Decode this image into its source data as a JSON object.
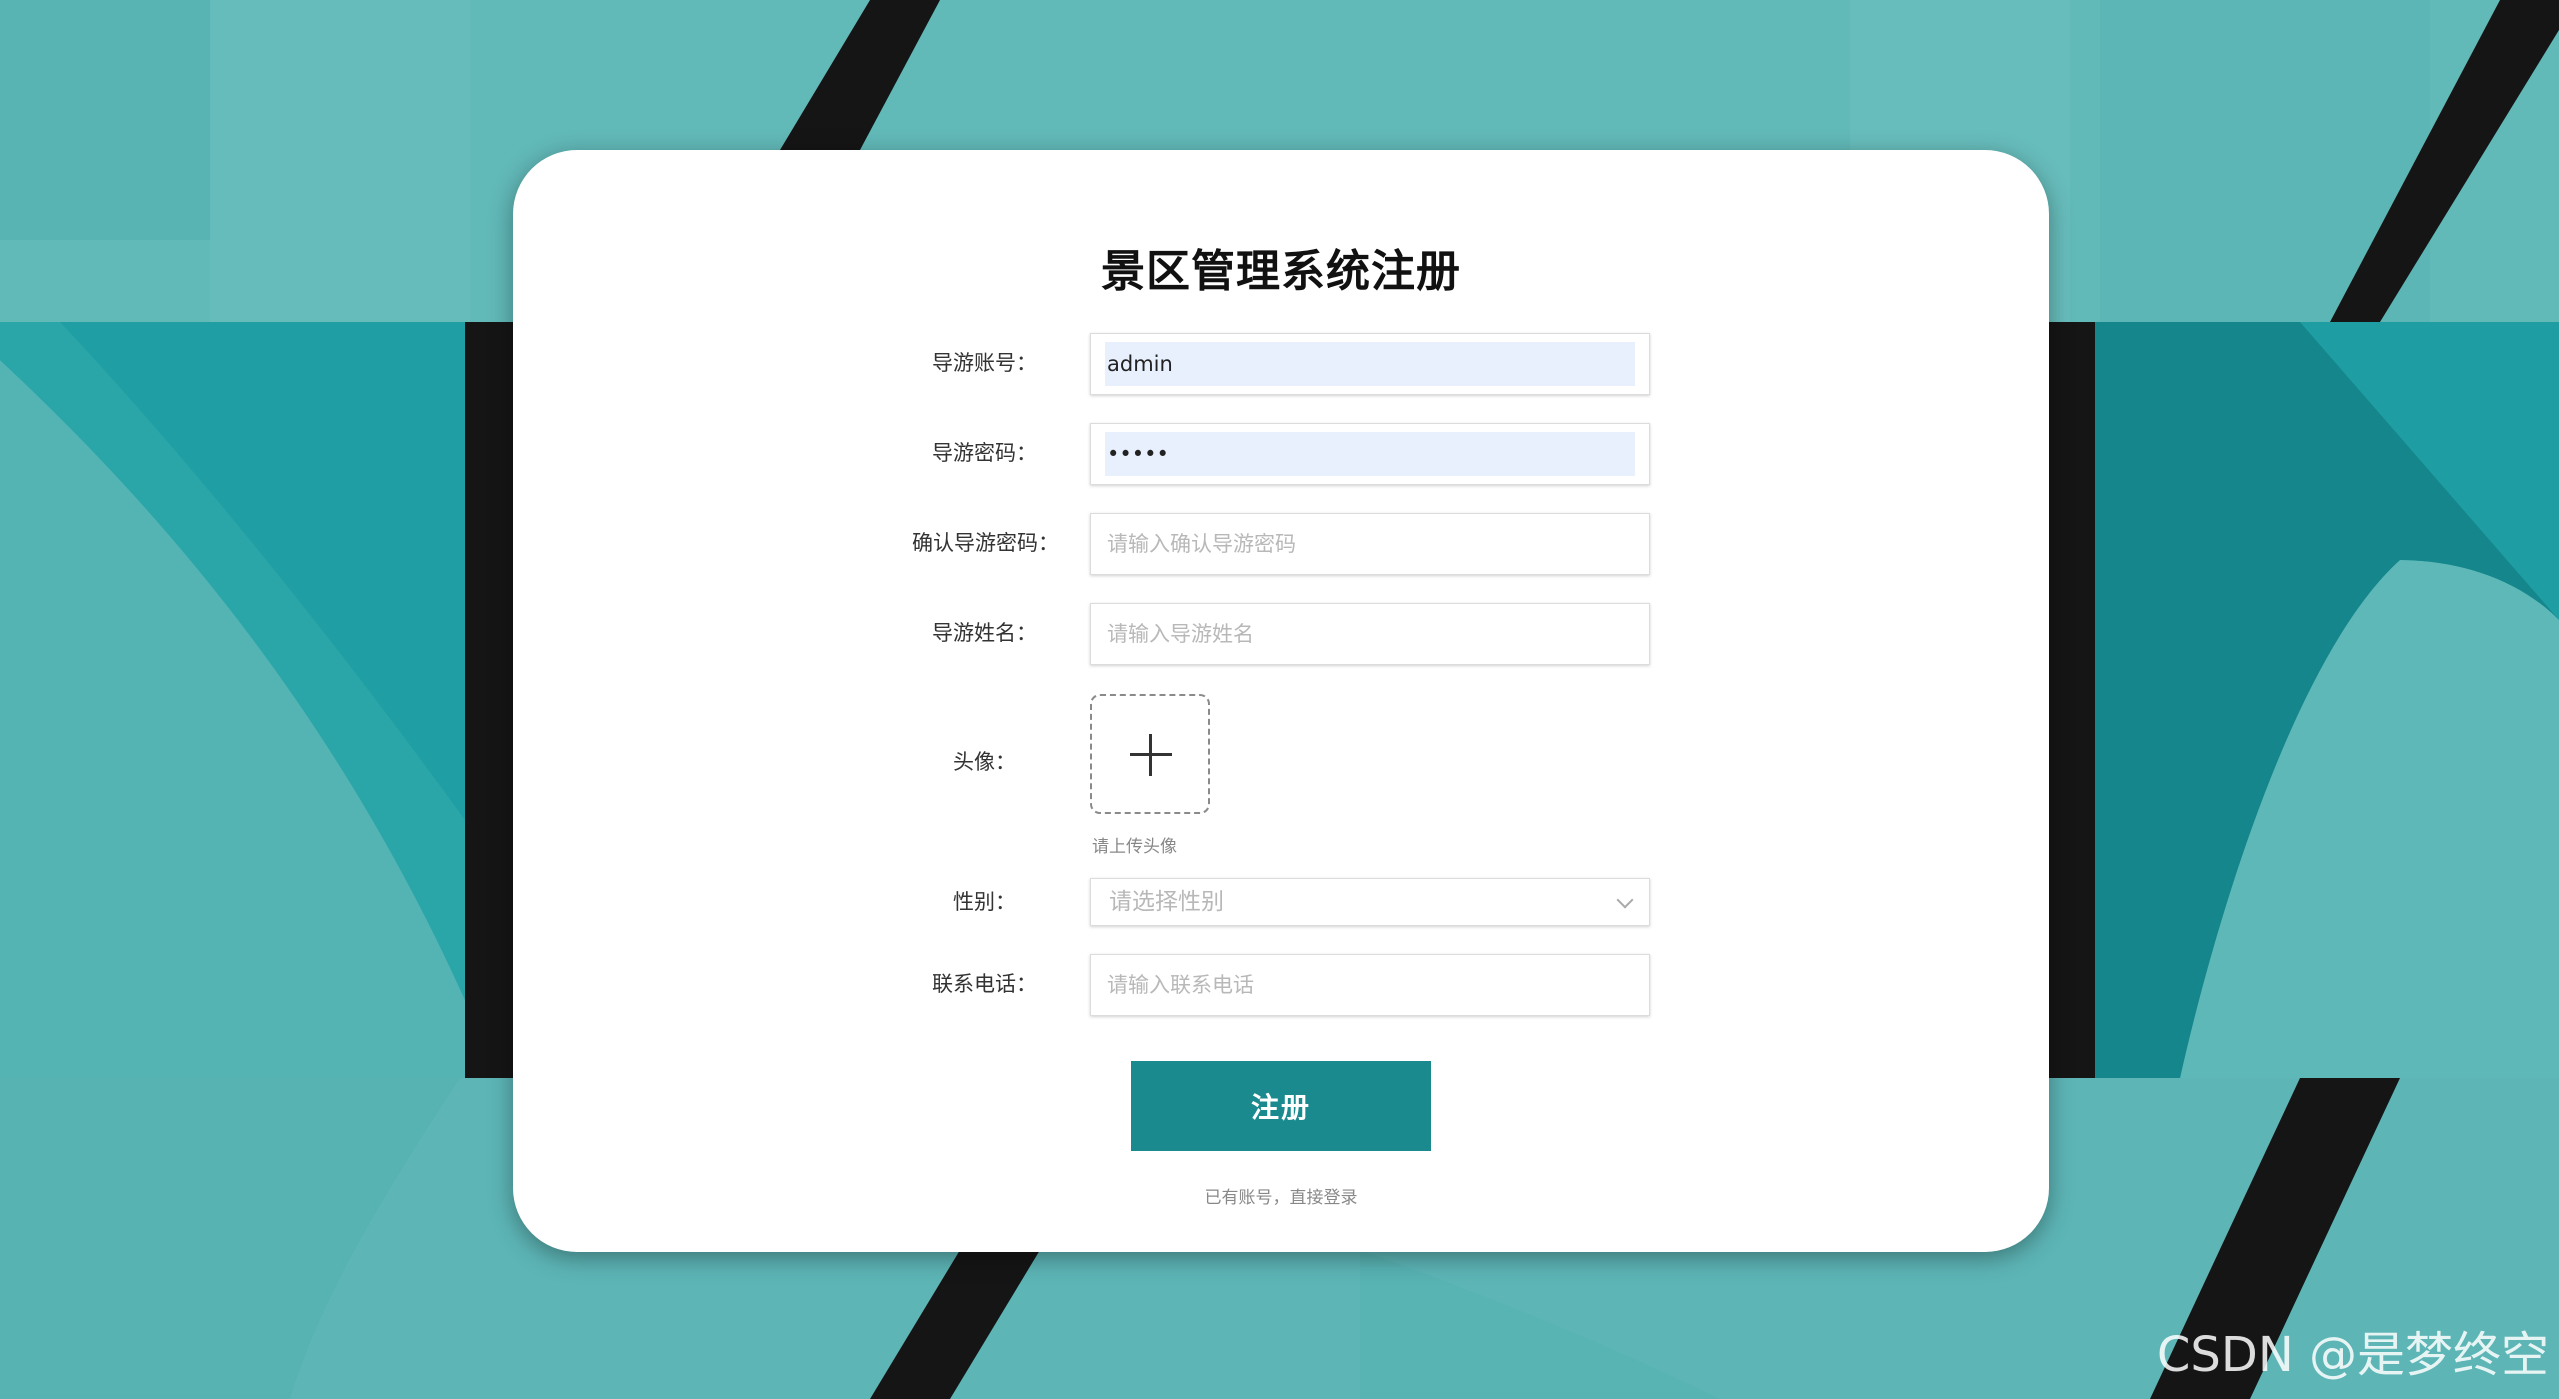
{
  "page": {
    "title": "景区管理系统注册"
  },
  "form": {
    "username": {
      "label": "导游账号：",
      "value": "admin",
      "placeholder": ""
    },
    "password": {
      "label": "导游密码：",
      "value": "•••••",
      "placeholder": ""
    },
    "confirm_password": {
      "label": "确认导游密码：",
      "value": "",
      "placeholder": "请输入确认导游密码"
    },
    "name": {
      "label": "导游姓名：",
      "value": "",
      "placeholder": "请输入导游姓名"
    },
    "avatar": {
      "label": "头像：",
      "hint": "请上传头像"
    },
    "gender": {
      "label": "性别：",
      "placeholder": "请选择性别"
    },
    "phone": {
      "label": "联系电话：",
      "value": "",
      "placeholder": "请输入联系电话"
    }
  },
  "actions": {
    "submit_label": "注册",
    "login_link": "已有账号，直接登录"
  },
  "watermark": "CSDN @是梦终空",
  "colors": {
    "primary": "#1b8a8e",
    "background_teal": "#5fb8b8",
    "background_dark": "#151515",
    "autofill": "#e8f0fe"
  }
}
